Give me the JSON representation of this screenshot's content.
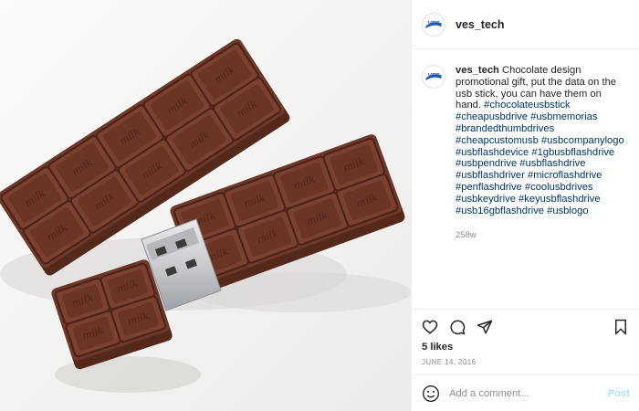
{
  "post": {
    "username": "ves_tech",
    "avatar_text": "VES",
    "caption": {
      "text": "Chocolate design promotional gift, put the data on the usb stick, you can have them on hand.",
      "hashtags": [
        "#chocolateusbstick",
        "#cheapusbdrive",
        "#usbmemorias",
        "#brandedthumbdrives",
        "#cheapcustomusb",
        "#usbcompanylogo",
        "#usbflashdevice",
        "#1gbusbflashdrive",
        "#usbpendrive",
        "#usbflashdrive",
        "#usbflashdriver",
        "#microflashdrive",
        "#penflashdrive",
        "#coolusbdrives",
        "#usbkeydrive",
        "#keyusbflashdrive",
        "#usb16gbflashdrive",
        "#usblogo"
      ]
    },
    "time_ago": "258w",
    "likes": "5 likes",
    "date": "JUNE 14, 2016"
  },
  "photo": {
    "subject": "chocolate-bar-usb-drives",
    "embossed_text": "milk"
  },
  "icons": {
    "avatar": "ves-logo-icon",
    "like": "heart-icon",
    "comment": "comment-bubble-icon",
    "share": "paper-plane-icon",
    "save": "bookmark-icon",
    "emoji": "smiley-icon"
  },
  "comment_box": {
    "placeholder": "Add a comment...",
    "post_label": "Post"
  },
  "colors": {
    "hashtag": "#00376b",
    "brand_blue": "#1c5bb0",
    "post_disabled": "#b2dffc",
    "chocolate": "#6e3828"
  }
}
